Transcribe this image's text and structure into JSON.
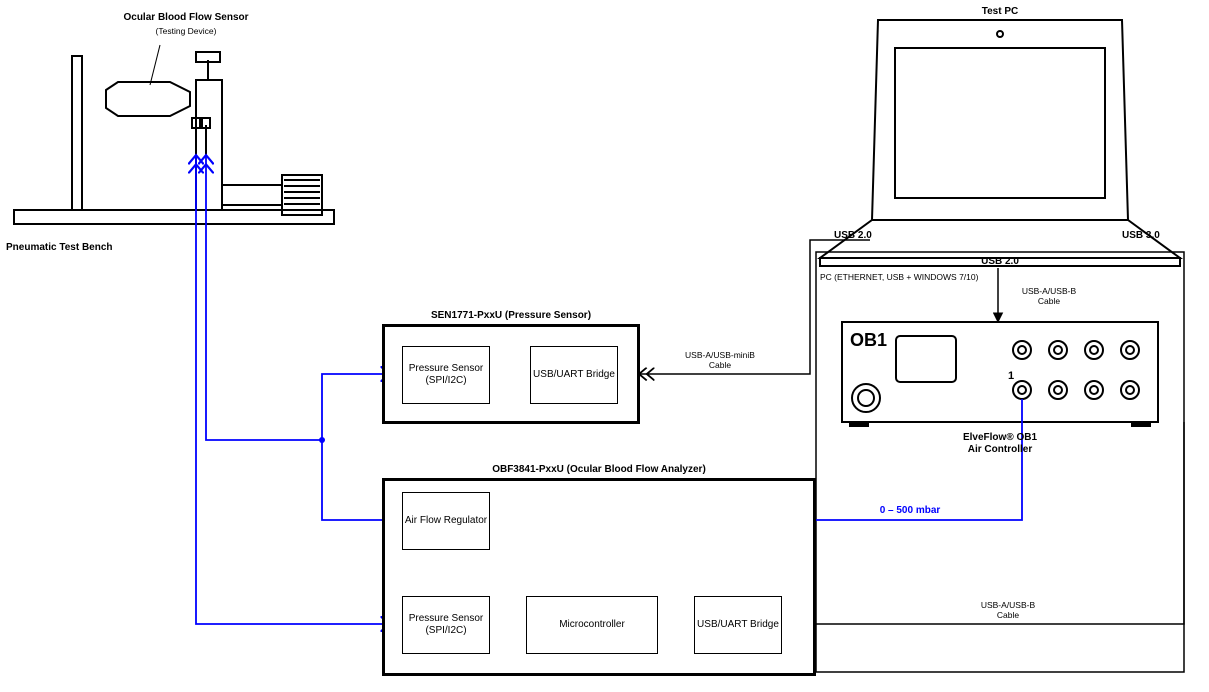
{
  "sensor": {
    "title": "Ocular Blood Flow Sensor",
    "subtitle": "(Testing Device)"
  },
  "bench": {
    "label": "Pneumatic Test Bench"
  },
  "sen1771": {
    "title": "SEN1771-PxxU (Pressure Sensor)",
    "pressure_sensor": "Pressure\nSensor\n(SPI/I2C)",
    "bridge": "USB/UART\nBridge",
    "cable": "USB-A/USB-miniB\nCable"
  },
  "obf3841": {
    "title": "OBF3841-PxxU (Ocular Blood Flow Analyzer)",
    "air_flow_reg": "Air Flow\nRegulator",
    "pressure_sensor": "Pressure\nSensor\n(SPI/I2C)",
    "microcontroller": "Microcontroller",
    "bridge": "USB/UART\nBridge",
    "cable": "USB-A/USB-B\nCable",
    "air_range": "0 – 500 mbar"
  },
  "pc": {
    "title": "Test PC",
    "usb20_left": "USB 2.0",
    "usb30_right": "USB 3.0",
    "usb20_bottom": "USB 2.0",
    "pc_req": "PC (ETHERNET, USB + WINDOWS 7/10)",
    "cable": "USB-A/USB-B\nCable"
  },
  "ob1": {
    "brand": "OB1",
    "port1": "1",
    "caption": "ElveFlow® OB1\nAir Controller"
  }
}
